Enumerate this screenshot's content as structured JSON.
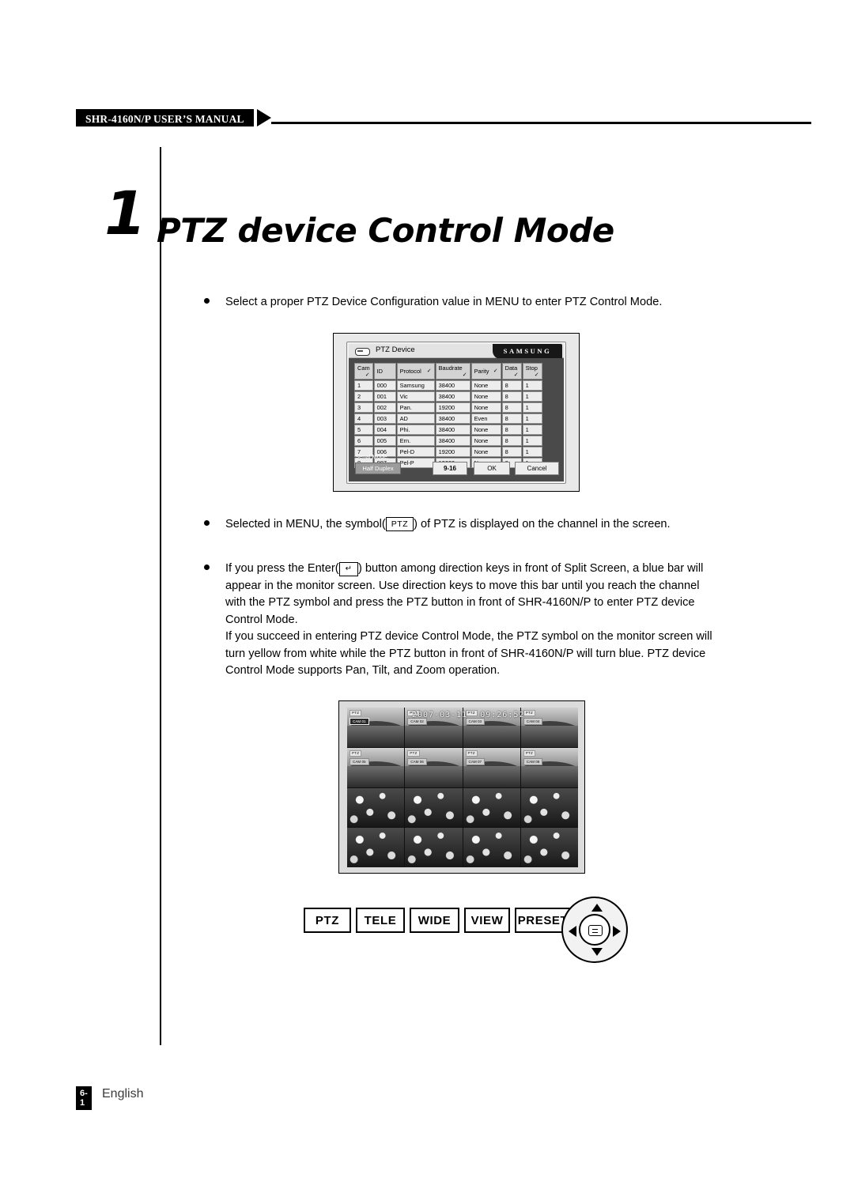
{
  "header": {
    "manual_title": "SHR-4160N/P USER’S MANUAL"
  },
  "chapter": {
    "number": "1",
    "title": "PTZ device Control Mode"
  },
  "bullets": {
    "b1_part1": "Select a proper PTZ Device Configuration value in MENU to enter PTZ Control Mode.",
    "b2_pre": "Selected in MENU, the symbol(",
    "b2_key": "PTZ",
    "b2_post": ") of PTZ is displayed on the channel in the screen.",
    "b3_pre": "If you press the Enter(",
    "b3_key": "↵",
    "b3_post": ") button among direction keys in front of Split Screen, a blue bar will appear in the monitor screen. Use direction keys to move this bar until you reach the channel with the PTZ symbol and press the PTZ button in front of SHR-4160N/P to enter PTZ device Control Mode.",
    "b3_para2": "If you succeed in entering PTZ device Control Mode, the PTZ symbol on the monitor screen will turn yellow from white while the PTZ button in front of SHR-4160N/P will turn blue. PTZ device Control Mode supports Pan, Tilt, and Zoom operation."
  },
  "dialog": {
    "title": "PTZ Device",
    "brand": "SAMSUNG",
    "columns": [
      "Cam",
      "ID",
      "Protocol",
      "Baudrate",
      "Parity",
      "Data",
      "Stop"
    ],
    "column_checks": [
      true,
      false,
      true,
      true,
      true,
      true,
      true
    ],
    "rows": [
      {
        "cam": "1",
        "id": "000",
        "protocol": "Samsung",
        "baudrate": "38400",
        "parity": "None",
        "data": "8",
        "stop": "1"
      },
      {
        "cam": "2",
        "id": "001",
        "protocol": "Vic",
        "baudrate": "38400",
        "parity": "None",
        "data": "8",
        "stop": "1"
      },
      {
        "cam": "3",
        "id": "002",
        "protocol": "Pan.",
        "baudrate": "19200",
        "parity": "None",
        "data": "8",
        "stop": "1"
      },
      {
        "cam": "4",
        "id": "003",
        "protocol": "AD",
        "baudrate": "38400",
        "parity": "Even",
        "data": "8",
        "stop": "1"
      },
      {
        "cam": "5",
        "id": "004",
        "protocol": "Phi.",
        "baudrate": "38400",
        "parity": "None",
        "data": "8",
        "stop": "1"
      },
      {
        "cam": "6",
        "id": "005",
        "protocol": "Ern.",
        "baudrate": "38400",
        "parity": "None",
        "data": "8",
        "stop": "1"
      },
      {
        "cam": "7",
        "id": "006",
        "protocol": "Pel-D",
        "baudrate": "19200",
        "parity": "None",
        "data": "8",
        "stop": "1"
      },
      {
        "cam": "8",
        "id": "007",
        "protocol": "Pel-P",
        "baudrate": "19200",
        "parity": "None",
        "data": "8",
        "stop": "1"
      }
    ],
    "serial_label": "Serial Mode:",
    "serial_value": "Half Duplex",
    "btn_range": "9-16",
    "btn_ok": "OK",
    "btn_cancel": "Cancel"
  },
  "monitor": {
    "osd_date": "2007-03-11",
    "osd_time": "09:26:52",
    "ptz_tag": "PTZ",
    "channels": [
      {
        "cam": "CAM 01",
        "selected": true
      },
      {
        "cam": "CAM 02",
        "selected": false
      },
      {
        "cam": "CAM 03",
        "selected": false
      },
      {
        "cam": "CAM 04",
        "selected": false
      },
      {
        "cam": "CAM 05",
        "selected": false
      },
      {
        "cam": "CAM 06",
        "selected": false
      },
      {
        "cam": "CAM 07",
        "selected": false
      },
      {
        "cam": "CAM 08",
        "selected": false
      }
    ]
  },
  "buttons": {
    "ptz": "PTZ",
    "tele": "TELE",
    "wide": "WIDE",
    "view": "VIEW",
    "preset": "PRESET"
  },
  "footer": {
    "page": "6-1",
    "language": "English"
  }
}
